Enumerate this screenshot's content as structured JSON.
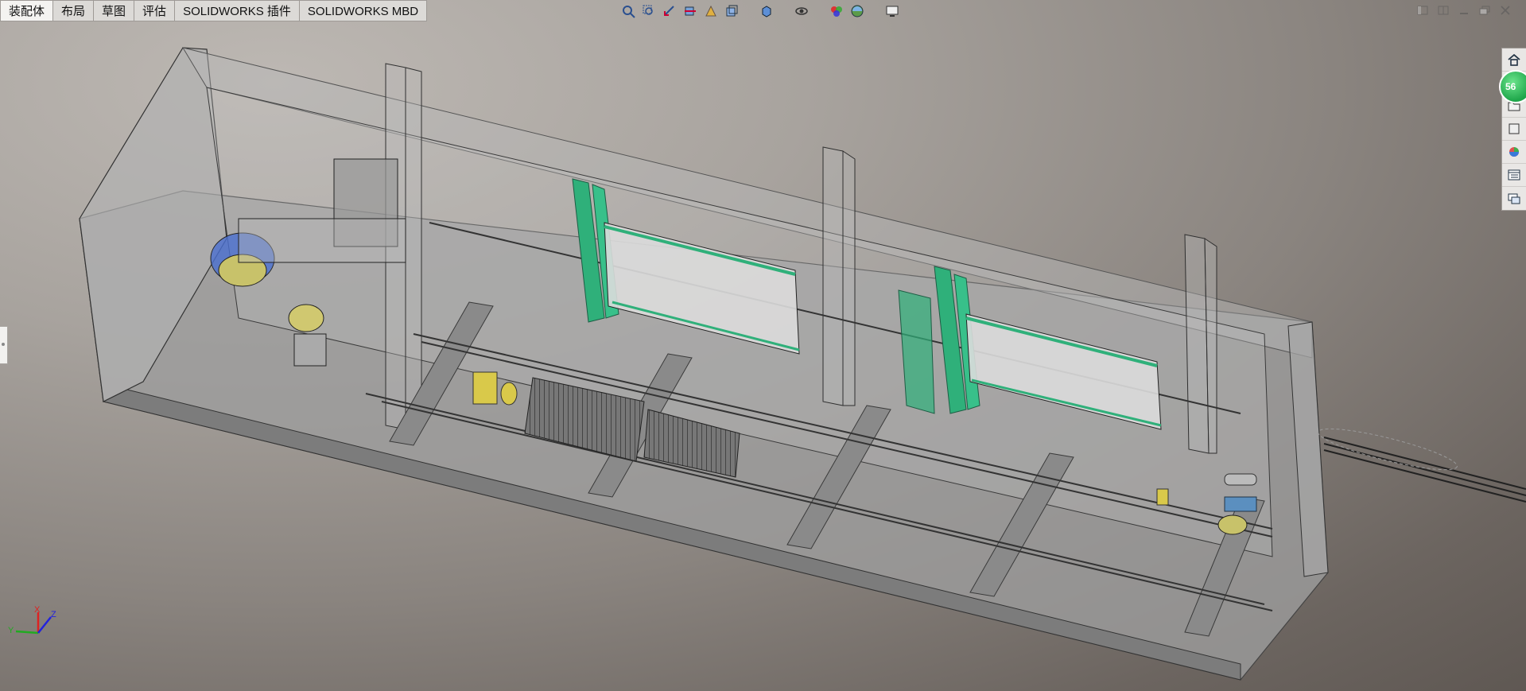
{
  "command_manager": {
    "tabs": [
      {
        "label": "装配体",
        "active": true
      },
      {
        "label": "布局",
        "active": false
      },
      {
        "label": "草图",
        "active": false
      },
      {
        "label": "评估",
        "active": false
      },
      {
        "label": "SOLIDWORKS 插件",
        "active": false
      },
      {
        "label": "SOLIDWORKS MBD",
        "active": false
      }
    ]
  },
  "heads_up_toolbar": {
    "icons": [
      "zoom-to-fit-icon",
      "zoom-to-area-icon",
      "previous-view-icon",
      "section-view-icon",
      "dynamic-annotation-view-icon",
      "view-orientation-icon",
      "display-style-icon",
      "hide-show-items-icon",
      "edit-appearance-icon",
      "apply-scene-icon",
      "view-settings-icon"
    ]
  },
  "window_controls": [
    "restore-icon",
    "tile-icon",
    "minimize-icon",
    "maximize-icon",
    "close-icon"
  ],
  "task_pane": {
    "items": [
      "solidworks-resources-icon",
      "design-library-icon",
      "file-explorer-icon",
      "view-palette-icon",
      "appearances-scenes-icon",
      "custom-properties-icon",
      "forum-icon"
    ],
    "notification_count": "56"
  },
  "triad": {
    "axes": [
      "X",
      "Y",
      "Z"
    ]
  },
  "colors": {
    "accent_green": "#2fb07a",
    "model_gray": "#8d8d8d",
    "part_yellow": "#d9c94a",
    "part_blue": "#4a6fd1"
  }
}
